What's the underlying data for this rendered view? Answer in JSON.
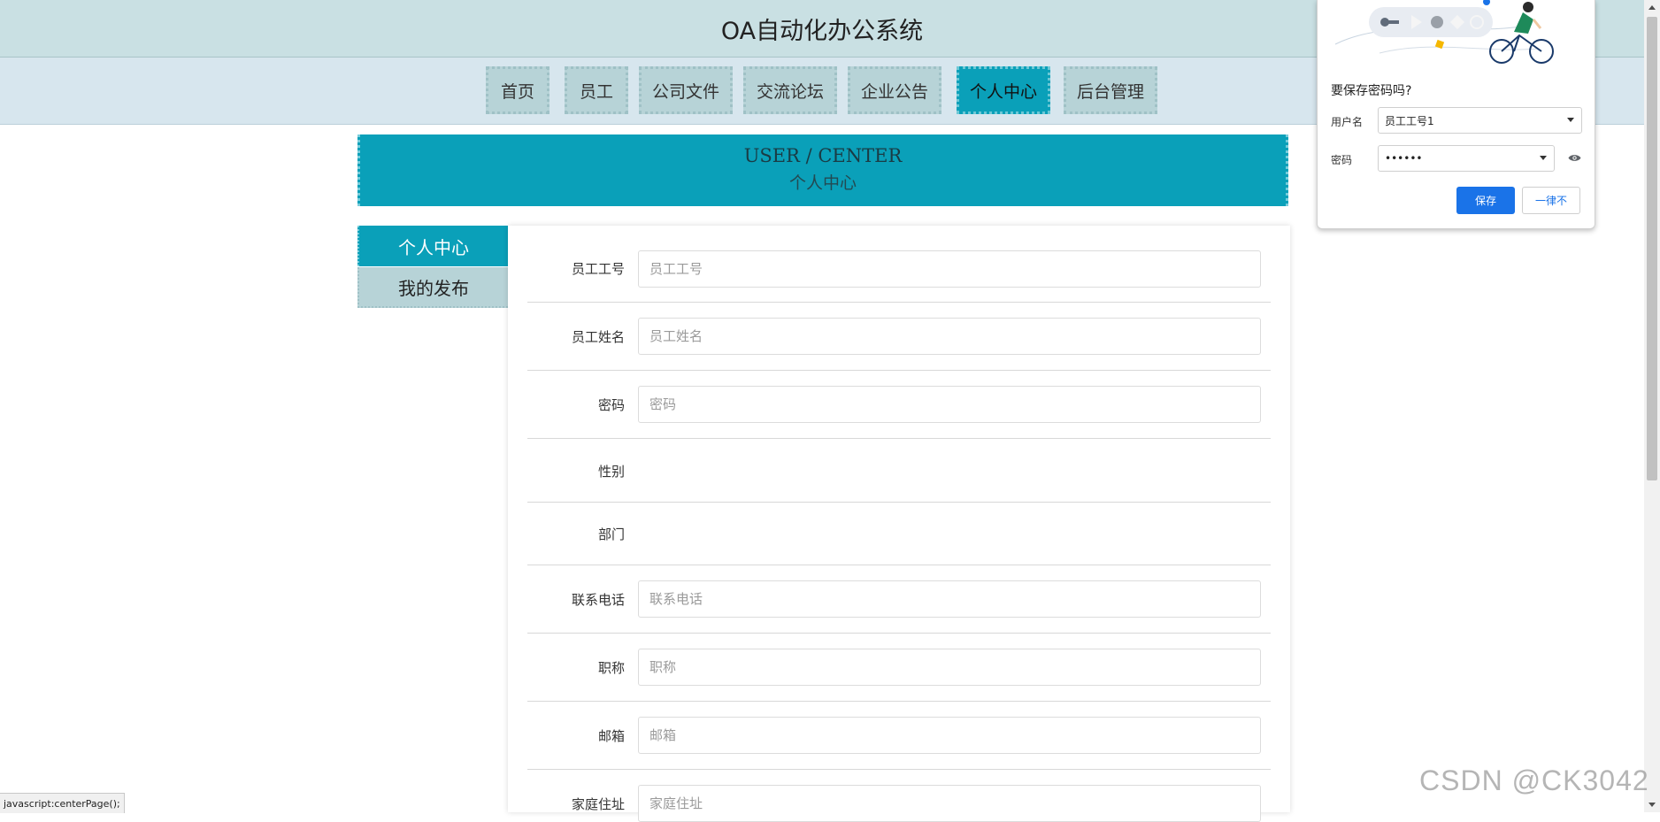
{
  "app": {
    "title": "OA自动化办公系统"
  },
  "nav": {
    "items": [
      {
        "label": "首页"
      },
      {
        "label": "员工"
      },
      {
        "label": "公司文件"
      },
      {
        "label": "交流论坛"
      },
      {
        "label": "企业公告"
      },
      {
        "label": "个人中心",
        "active": true
      },
      {
        "label": "后台管理"
      }
    ]
  },
  "banner": {
    "en": "USER / CENTER",
    "cn": "个人中心"
  },
  "side_menu": {
    "items": [
      {
        "label": "个人中心",
        "active": true
      },
      {
        "label": "我的发布"
      }
    ]
  },
  "form": {
    "fields": [
      {
        "label": "员工工号",
        "placeholder": "员工工号",
        "value": ""
      },
      {
        "label": "员工姓名",
        "placeholder": "员工姓名",
        "value": ""
      },
      {
        "label": "密码",
        "placeholder": "密码",
        "value": ""
      },
      {
        "label": "性别"
      },
      {
        "label": "部门"
      },
      {
        "label": "联系电话",
        "placeholder": "联系电话",
        "value": ""
      },
      {
        "label": "职称",
        "placeholder": "职称",
        "value": ""
      },
      {
        "label": "邮箱",
        "placeholder": "邮箱",
        "value": ""
      },
      {
        "label": "家庭住址",
        "placeholder": "家庭住址",
        "value": ""
      }
    ]
  },
  "password_popup": {
    "question": "要保存密码吗?",
    "username_label": "用户名",
    "username_value": "员工工号1",
    "password_label": "密码",
    "password_value": "••••••",
    "save_label": "保存",
    "never_label": "一律不"
  },
  "status_bar": {
    "text": "javascript:centerPage();"
  },
  "watermark": {
    "text": "CSDN @CK3042"
  },
  "colors": {
    "accent": "#0aa0b9",
    "nav_bg": "#b7d3d7",
    "header_bg": "#c9e0e3",
    "primary_button": "#1a73e8"
  }
}
